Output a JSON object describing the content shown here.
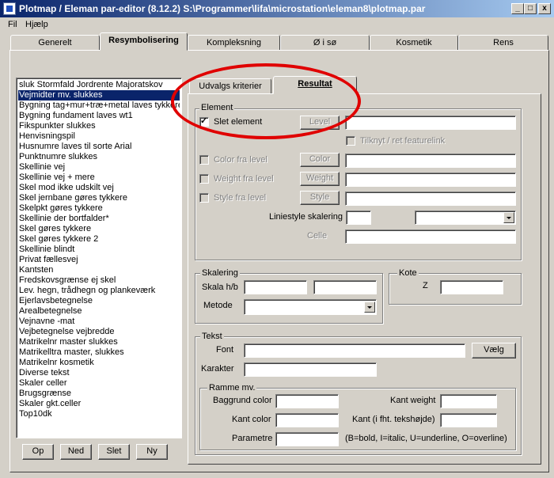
{
  "window": {
    "title": "Plotmap / Eleman par-editor (8.12.2) S:\\Programmer\\lifa\\microstation\\eleman8\\plotmap.par",
    "min_label": "_",
    "max_label": "□",
    "close_label": "x"
  },
  "menu": [
    "Fil",
    "Hjælp"
  ],
  "tabs": [
    "Generelt",
    "Resymbolisering",
    "Kompleksning",
    "Ø i sø",
    "Kosmetik",
    "Rens"
  ],
  "list": {
    "items": [
      "sluk Stormfald Jordrente Majoratskov",
      "Vejmidter mv. slukkes",
      "Bygning tag+mur+træ+metal laves tykkere",
      "Bygning fundament laves wt1",
      "Fikspunkter slukkes",
      "Henvisningspil",
      "Husnumre laves til sorte Arial",
      "Punktnumre slukkes",
      "Skellinie vej",
      "Skellinie vej + mere",
      "Skel mod ikke udskilt vej",
      "Skel jernbane gøres tykkere",
      "Skelpkt gøres tykkere",
      "Skellinie der bortfalder*",
      "Skel gøres tykkere",
      "Skel gøres tykkere 2",
      "Skellinie blindt",
      "Privat fællesvej",
      "Kantsten",
      "Fredskovsgrænse ej skel",
      "Lev. hegn, trådhegn og plankeværk",
      "Ejerlavsbetegnelse",
      "Arealbetegnelse",
      "Vejnavne -mat",
      "Vejbetegnelse vejbredde",
      "Matrikelnr master slukkes",
      "Matrikelltra master, slukkes",
      "Matrikelnr kosmetik",
      "Diverse tekst",
      "Skaler celler",
      "Brugsgrænse",
      "Skaler gkt.celler",
      "Top10dk"
    ],
    "selected_index": 1
  },
  "list_buttons": [
    "Op",
    "Ned",
    "Slet",
    "Ny"
  ],
  "subtabs": [
    "Udvalgs kriterier",
    "Resultat"
  ],
  "element_group": {
    "label": "Element",
    "slet_element": "Slet element",
    "level_btn": "Level",
    "tilknyt": "Tilknyt / ret featurelink",
    "color_fra_level": "Color fra level",
    "color_btn": "Color",
    "weight_fra_level": "Weight fra level",
    "weight_btn": "Weight",
    "style_fra_level": "Style fra level",
    "style_btn": "Style",
    "liniestyle_label": "Liniestyle skalering",
    "celle_label": "Celle"
  },
  "skalering_group": {
    "label": "Skalering",
    "skala_label": "Skala h/b",
    "metode_label": "Metode"
  },
  "kote_group": {
    "label": "Kote",
    "z_label": "Z"
  },
  "tekst_group": {
    "label": "Tekst",
    "font_label": "Font",
    "vaelg_btn": "Vælg",
    "karakter_label": "Karakter"
  },
  "ramme_group": {
    "label": "Ramme mv.",
    "baggrund_label": "Baggrund color",
    "kant_weight_label": "Kant weight",
    "kant_color_label": "Kant color",
    "kant_label": "Kant (i fht. tekshøjde)",
    "parametre_label": "Parametre",
    "parametre_hint": "(B=bold, I=italic, U=underline, O=overline)"
  },
  "colors": {
    "title_start": "#0a246a",
    "title_end": "#a6caf0",
    "selection": "#0a246a",
    "annotation": "#e00000"
  }
}
